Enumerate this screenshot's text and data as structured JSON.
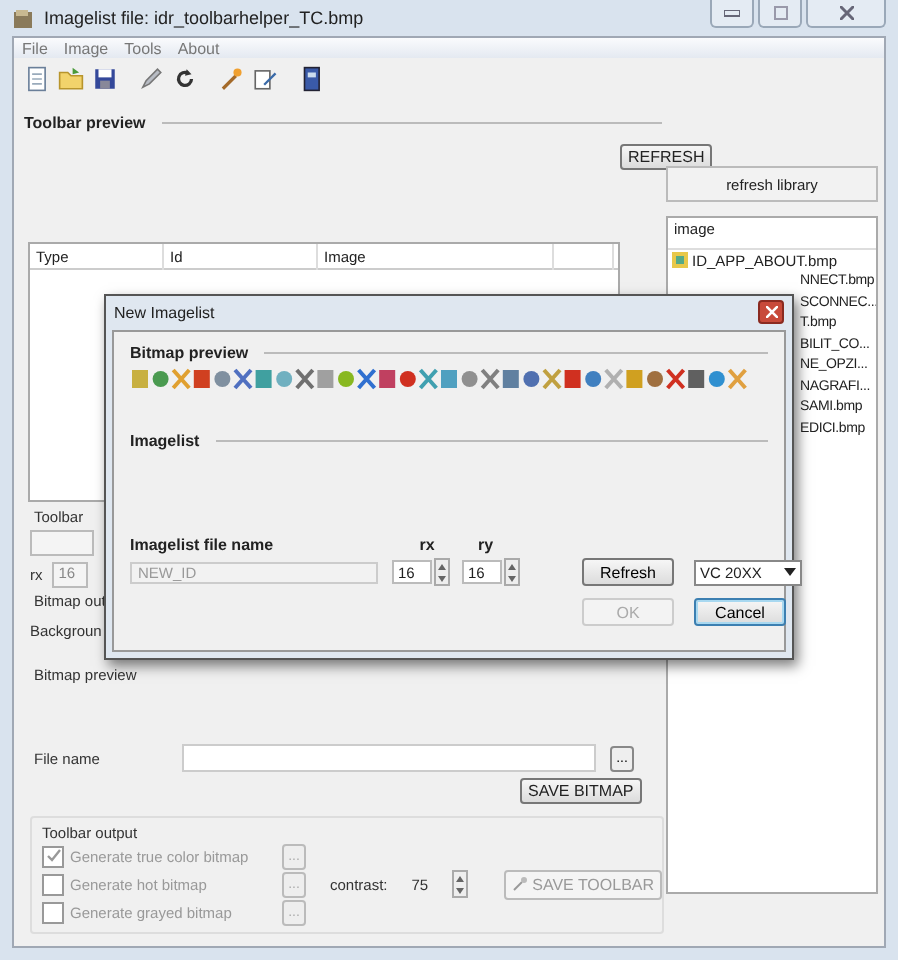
{
  "window": {
    "title": "Imagelist file: idr_toolbarhelper_TC.bmp"
  },
  "menu": [
    "File",
    "Image",
    "Tools",
    "About"
  ],
  "toolbar": [
    {
      "kind": "document"
    },
    {
      "kind": "folder"
    },
    {
      "kind": "floppy"
    },
    {
      "kind": "pencil"
    },
    {
      "kind": "refresh"
    },
    {
      "kind": "wand"
    },
    {
      "kind": "edit"
    },
    {
      "kind": "book"
    }
  ],
  "toolbar_preview": {
    "title": "Toolbar preview",
    "refresh_button": "REFRESH"
  },
  "table": {
    "columns": [
      "Type",
      "Id",
      "Image"
    ]
  },
  "library": {
    "button": "refresh library",
    "header": "image",
    "items": [
      {
        "kind": "entry",
        "label": "ID_APP_ABOUT.bmp"
      },
      {
        "kind": "clipped",
        "label": "NNECT.bmp"
      },
      {
        "kind": "clipped",
        "label": "SCONNEC..."
      },
      {
        "kind": "clipped",
        "label": "T.bmp"
      },
      {
        "kind": "clipped",
        "label": "BILIT_CO..."
      },
      {
        "kind": "clipped",
        "label": "NE_OPZI..."
      },
      {
        "kind": "clipped",
        "label": "NAGRAFI..."
      },
      {
        "kind": "clipped",
        "label": "SAMI.bmp"
      },
      {
        "kind": "clipped",
        "label": "EDICI.bmp"
      }
    ]
  },
  "toolbar_settings": {
    "label": "Toolbar",
    "rx_label": "rx",
    "rx_value": "16",
    "bitmap_output_label": "Bitmap out",
    "background_label": "Backgroun"
  },
  "bitmap_preview": {
    "label": "Bitmap preview"
  },
  "file_name": {
    "label": "File name",
    "browse": "...",
    "save_button": "SAVE BITMAP"
  },
  "toolbar_output": {
    "title": "Toolbar output",
    "options": [
      {
        "label": "Generate true color bitmap",
        "checked": true,
        "disabled": true,
        "browse": "..."
      },
      {
        "label": "Generate hot bitmap",
        "checked": false,
        "disabled": true,
        "browse": "..."
      },
      {
        "label": "Generate grayed bitmap",
        "checked": false,
        "disabled": true,
        "browse": "..."
      }
    ],
    "contrast_label": "contrast:",
    "contrast_value": "75",
    "save_button": "SAVE TOOLBAR",
    "save_disabled": true
  },
  "dialog": {
    "title": "New Imagelist",
    "bitmap_preview": "Bitmap preview",
    "imagelist": "Imagelist",
    "file_name_label": "Imagelist file name",
    "file_name_value": "NEW_ID",
    "rx_label": "rx",
    "rx_value": "16",
    "ry_label": "ry",
    "ry_value": "16",
    "refresh": "Refresh",
    "compiler": "VC 20XX",
    "ok": "OK",
    "ok_disabled": true,
    "cancel": "Cancel"
  }
}
